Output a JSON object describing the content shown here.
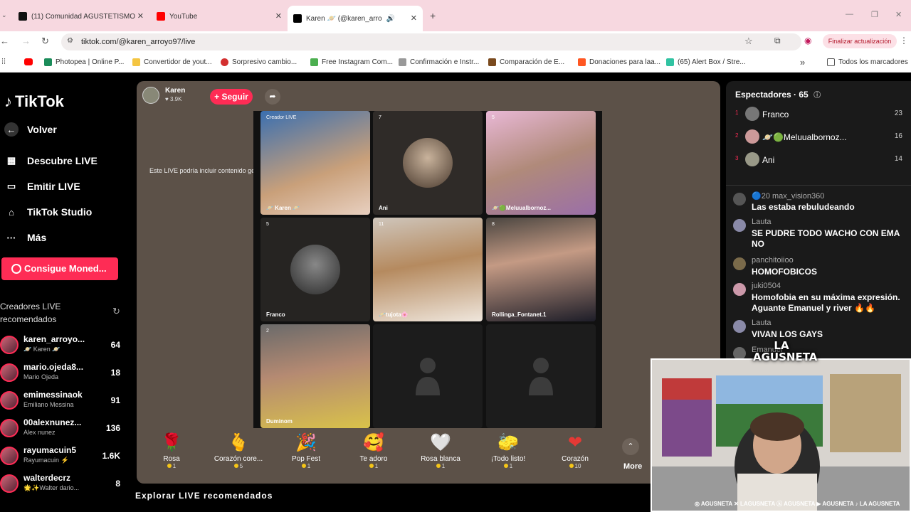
{
  "browser": {
    "tabs": [
      {
        "title": "(11) Comunidad AGUSTETISMO"
      },
      {
        "title": "YouTube"
      },
      {
        "title": "Karen 🪐 (@karen_arro"
      }
    ],
    "new_tab": "+",
    "url": "tiktok.com/@karen_arroyo97/live",
    "update_button": "Finalizar actualización",
    "bookmarks": [
      "Photopea | Online P...",
      "Convertidor de yout...",
      "Sorpresivo cambio...",
      "Free Instagram Com...",
      "Confirmación e Instr...",
      "Comparación de E...",
      "Donaciones para laa...",
      "(65) Alert Box / Stre..."
    ],
    "bookmarks_more": "»",
    "bookmarks_folder": "Todos los marcadores"
  },
  "sidebar": {
    "logo": "TikTok",
    "nav": [
      {
        "label": "Volver",
        "icon": "back-arrow-icon"
      },
      {
        "label": "Descubre LIVE",
        "icon": "calendar-icon"
      },
      {
        "label": "Emitir LIVE",
        "icon": "camera-icon"
      },
      {
        "label": "TikTok Studio",
        "icon": "home-icon"
      },
      {
        "label": "Más",
        "icon": "more-dots-icon"
      }
    ],
    "coins_button": "Consigue Moned...",
    "recommended_title": "Creadores LIVE recomendados",
    "creators": [
      {
        "name": "karen_arroyo...",
        "sub": "🪐 Karen 🪐",
        "count": "64"
      },
      {
        "name": "mario.ojeda8...",
        "sub": "Mario Ojeda",
        "count": "18"
      },
      {
        "name": "emimessinaok",
        "sub": "Emiliano Messina",
        "count": "91"
      },
      {
        "name": "00alexnunez...",
        "sub": "Alex nunez",
        "count": "136"
      },
      {
        "name": "rayumacuin5",
        "sub": "Rayumacuin ⚡",
        "count": "1.6K"
      },
      {
        "name": "walterdecrz",
        "sub": "🌟✨Walter dario...",
        "count": "8"
      }
    ]
  },
  "stream": {
    "host_name": "Karen",
    "host_likes": "♥ 3.9K",
    "follow_button": "+ Seguir",
    "ai_notice": "Este LIVE podría incluir contenido generado por IA",
    "participants": [
      {
        "label": "🪐 Karen 🪐",
        "badge": "Creador LIVE"
      },
      {
        "label": "Ani",
        "badge": "7"
      },
      {
        "label": "🪐🟢Meluualbornoz...",
        "badge": "5"
      },
      {
        "label": "Franco",
        "badge": "5"
      },
      {
        "label": "🪐tujota🌸",
        "badge": "11"
      },
      {
        "label": "Rollinga_Fontanet.1",
        "badge": "8"
      },
      {
        "label": "Duminom",
        "badge": "2"
      }
    ],
    "gifts": [
      {
        "name": "Rosa",
        "price": "1",
        "icon": "🌹"
      },
      {
        "name": "Corazón core...",
        "price": "5",
        "icon": "🫰"
      },
      {
        "name": "Pop Fest",
        "price": "1",
        "icon": "🎉"
      },
      {
        "name": "Te adoro",
        "price": "1",
        "icon": "🥰"
      },
      {
        "name": "Rosa blanca",
        "price": "1",
        "icon": "🤍"
      },
      {
        "name": "¡Todo listo!",
        "price": "1",
        "icon": "🧽"
      },
      {
        "name": "Corazón",
        "price": "10",
        "icon": "❤"
      }
    ],
    "more_label": "More",
    "bottom_text": "Explorar LIVE recomendados"
  },
  "viewers": {
    "title": "Espectadores · 65",
    "top": [
      {
        "rank": "1",
        "name": "Franco",
        "count": "23"
      },
      {
        "rank": "2",
        "name": "🪐🟢Meluualbornoz...",
        "count": "16"
      },
      {
        "rank": "3",
        "name": "Ani",
        "count": "14"
      }
    ]
  },
  "chat": [
    {
      "user": "🔵20 max_vision360",
      "message": "Las estaba rebuludeando"
    },
    {
      "user": "Lauta",
      "message": "SE PUDRE TODO WACHO CON EMA NO"
    },
    {
      "user": "panchitoiioo",
      "message": "HOMOFOBICOS"
    },
    {
      "user": "juki0504",
      "message": "Homofobia en su máxima expresión. Aguante Emanuel y river 🔥🔥"
    },
    {
      "user": "Lauta",
      "message": "VIVAN LOS GAYS"
    },
    {
      "user": "Emanuel",
      "message": ""
    }
  ],
  "webcam": {
    "watermark": "LA AGUSNETA",
    "socials": "◎ AGUSNETA ✕ LAGUSNETA ⓚ AGUSNETA ▶ AGUSNETA ♪ LA AGUSNETA"
  },
  "colors": {
    "accent": "#fe2c55",
    "panel": "#5c5148"
  }
}
